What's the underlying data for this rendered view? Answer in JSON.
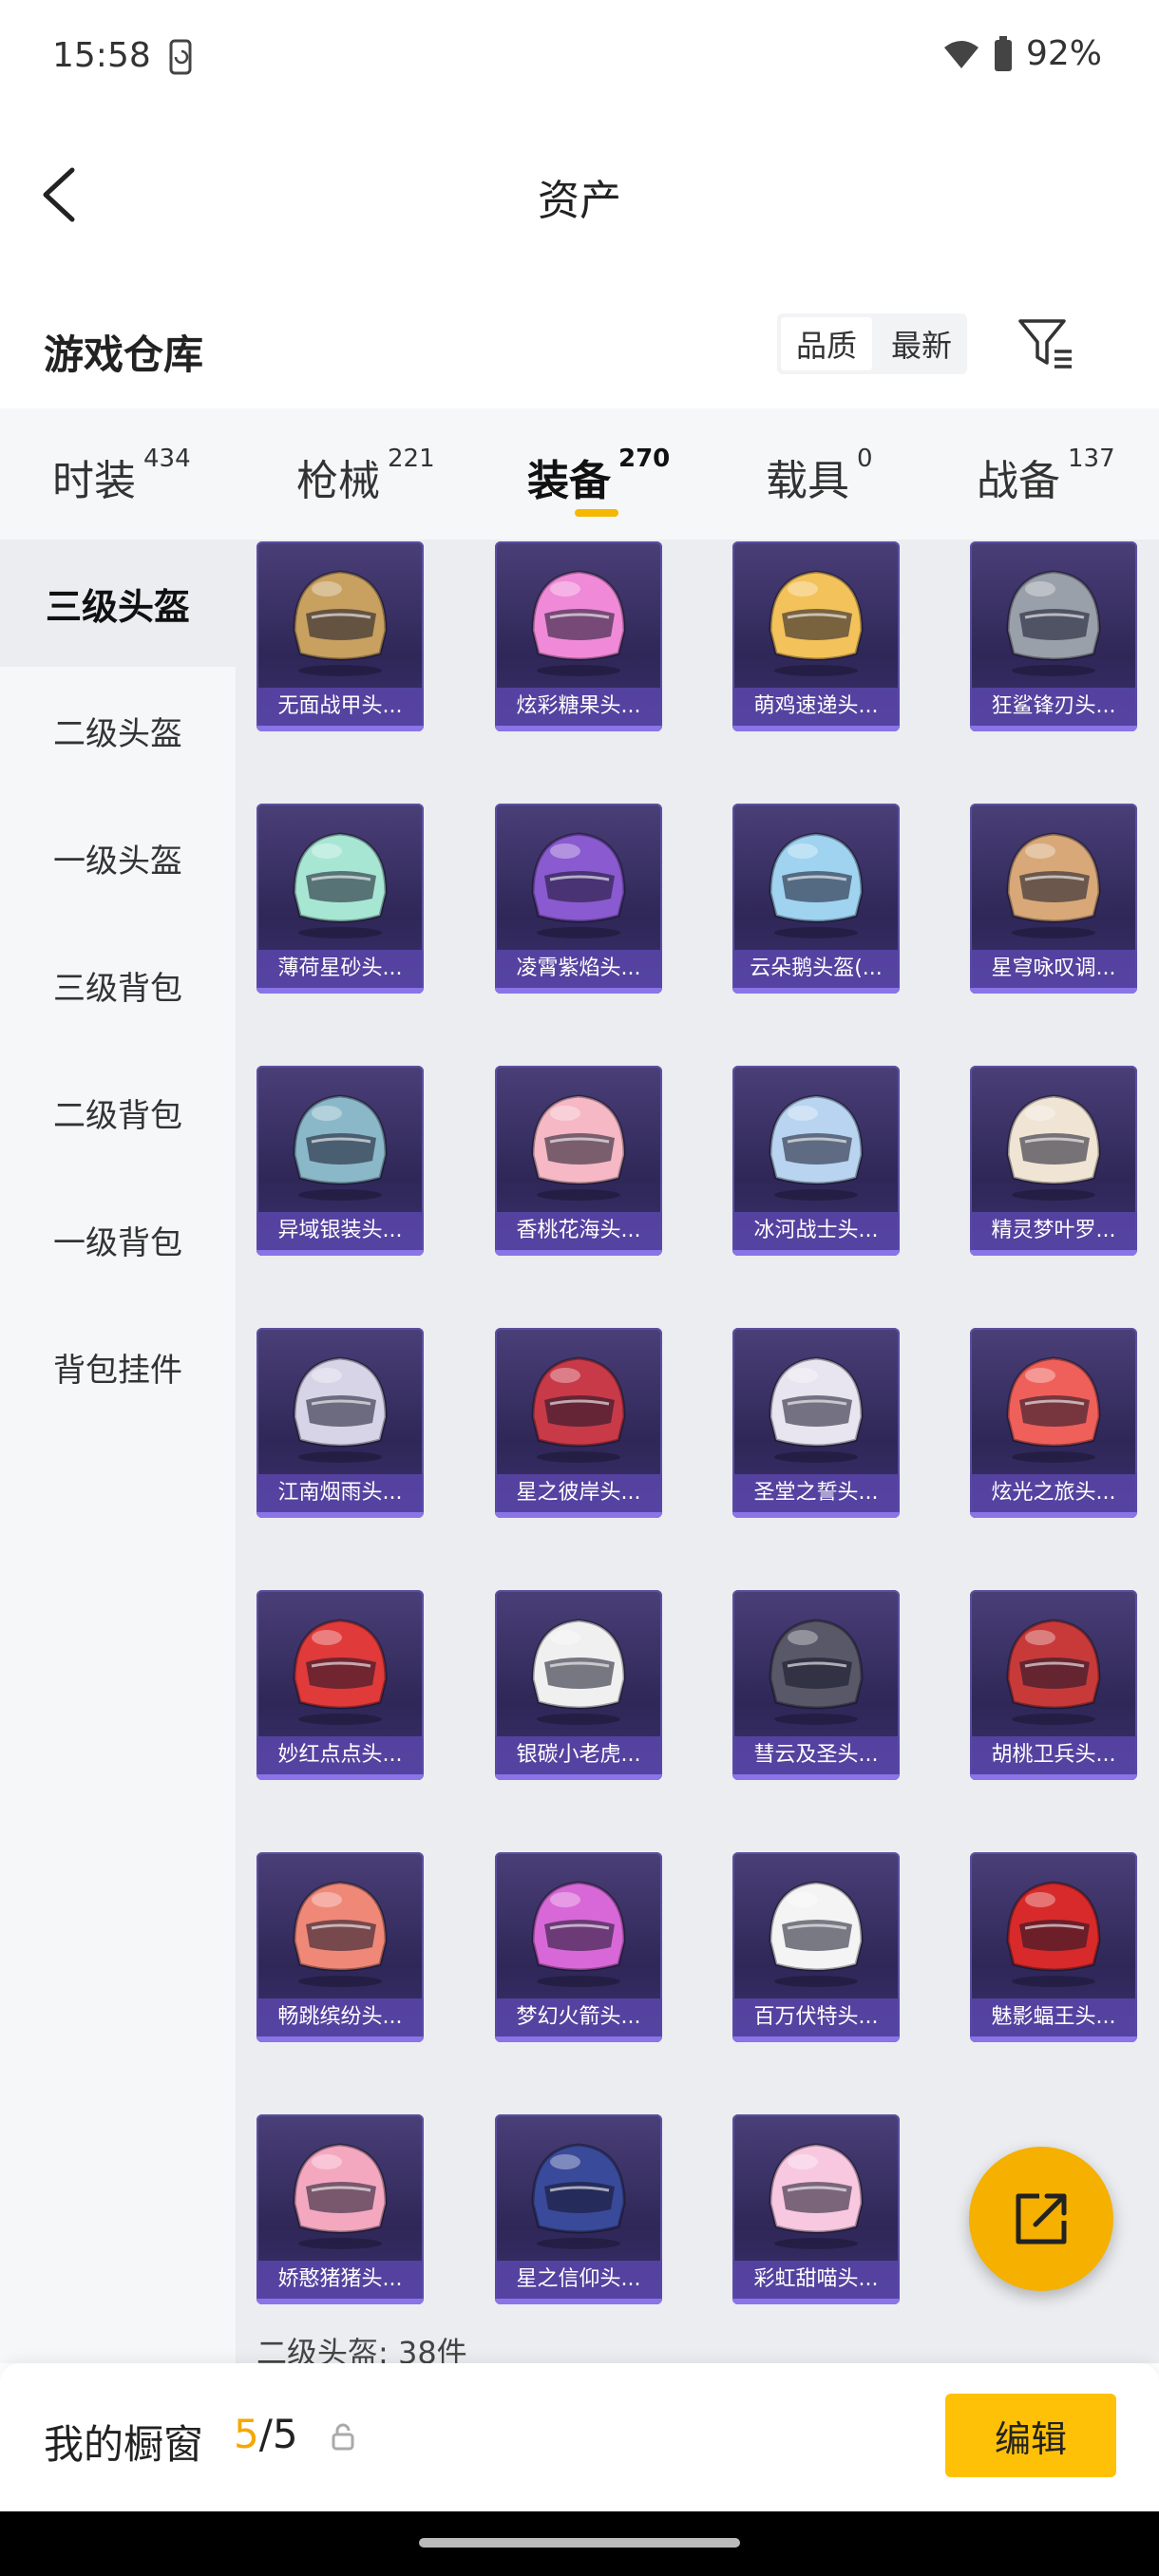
{
  "status_bar": {
    "time": "15:58",
    "battery": "92%"
  },
  "header": {
    "title": "资产"
  },
  "warehouse": {
    "title": "游戏仓库",
    "sort_options": [
      "品质",
      "最新"
    ]
  },
  "tabs": [
    {
      "label": "时装",
      "count": "434"
    },
    {
      "label": "枪械",
      "count": "221"
    },
    {
      "label": "装备",
      "count": "270"
    },
    {
      "label": "载具",
      "count": "0"
    },
    {
      "label": "战备",
      "count": "137"
    }
  ],
  "sidebar": {
    "items": [
      "三级头盔",
      "二级头盔",
      "一级头盔",
      "三级背包",
      "二级背包",
      "一级背包",
      "背包挂件"
    ]
  },
  "items": [
    {
      "name": "无面战甲头...",
      "color": "#c8a060"
    },
    {
      "name": "炫彩糖果头...",
      "color": "#f08ad8"
    },
    {
      "name": "萌鸡速递头...",
      "color": "#f3c25a"
    },
    {
      "name": "狂鲨锋刃头...",
      "color": "#9aa0aa"
    },
    {
      "name": "薄荷星砂头...",
      "color": "#a8e6d4"
    },
    {
      "name": "凌霄紫焰头...",
      "color": "#8a5ad0"
    },
    {
      "name": "云朵鹅头盔(...",
      "color": "#9fd3f0"
    },
    {
      "name": "星穹咏叹调...",
      "color": "#d8a878"
    },
    {
      "name": "异域银装头...",
      "color": "#8ab8c8"
    },
    {
      "name": "香桃花海头...",
      "color": "#f5b8c4"
    },
    {
      "name": "冰河战士头...",
      "color": "#b8d4f0"
    },
    {
      "name": "精灵梦叶罗...",
      "color": "#f0e4d4"
    },
    {
      "name": "江南烟雨头...",
      "color": "#d8d4e8"
    },
    {
      "name": "星之彼岸头...",
      "color": "#c83a48"
    },
    {
      "name": "圣堂之誓头...",
      "color": "#e8e4f0"
    },
    {
      "name": "炫光之旅头...",
      "color": "#f0605a"
    },
    {
      "name": "妙红点点头...",
      "color": "#e03a3a"
    },
    {
      "name": "银碳小老虎...",
      "color": "#f0f0f0"
    },
    {
      "name": "彗云及圣头...",
      "color": "#585868"
    },
    {
      "name": "胡桃卫兵头...",
      "color": "#c83a3a"
    },
    {
      "name": "畅跳缤纷头...",
      "color": "#f08878"
    },
    {
      "name": "梦幻火箭头...",
      "color": "#d868d8"
    },
    {
      "name": "百万伏特头...",
      "color": "#f4f4f4"
    },
    {
      "name": "魅影蝠王头...",
      "color": "#d82a2a"
    },
    {
      "name": "娇憨猪猪头...",
      "color": "#f4a8c0"
    },
    {
      "name": "星之信仰头...",
      "color": "#3a4a9a"
    },
    {
      "name": "彩虹甜喵头...",
      "color": "#f8c8e0"
    }
  ],
  "grid_footer": "二级头盔: 38件",
  "showcase": {
    "label": "我的橱窗",
    "current": "5",
    "total": "/5",
    "edit_label": "编辑"
  }
}
